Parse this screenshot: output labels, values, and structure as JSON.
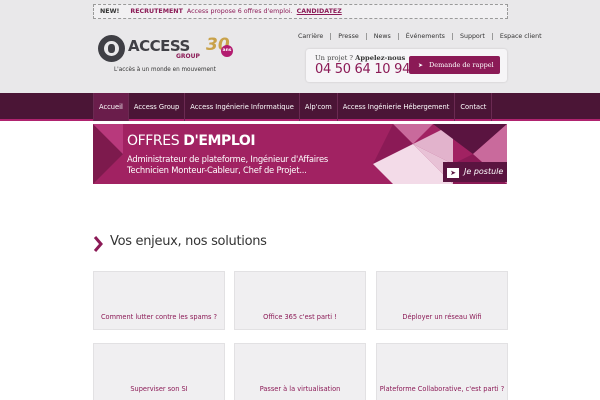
{
  "news": {
    "tag": "NEW!",
    "category": "RECRUTEMENT",
    "message": "Access propose 6 offres d'emploi.",
    "link": "CANDIDATEZ"
  },
  "logo": {
    "name": "ACCESS",
    "sub": "GROUP",
    "anniversary": "30",
    "anniversary_unit": "ans",
    "tagline": "L'accès à un monde en mouvement"
  },
  "top_nav": [
    "Carrière",
    "Presse",
    "News",
    "Événements",
    "Support",
    "Espace client"
  ],
  "call": {
    "prefix": "Un projet ?",
    "bold": "Appelez-nous",
    "phone": "04 50 64 10 94",
    "button": "Demande de rappel"
  },
  "main_nav": [
    {
      "label": "Accueil",
      "active": true
    },
    {
      "label": "Access Group",
      "active": false
    },
    {
      "label": "Access Ingénierie Informatique",
      "active": false
    },
    {
      "label": "Alp'com",
      "active": false
    },
    {
      "label": "Access Ingénierie Hébergement",
      "active": false
    },
    {
      "label": "Contact",
      "active": false
    }
  ],
  "banner": {
    "title_light": "OFFRES",
    "title_bold": "D'EMPLOI",
    "line1": "Administrateur de plateforme, Ingénieur d'Affaires",
    "line2": "Technicien Monteur-Cableur, Chef de Projet...",
    "button": "Je postule"
  },
  "section": {
    "title": "Vos enjeux, nos solutions"
  },
  "cards": [
    "Comment lutter contre les spams ?",
    "Office 365 c'est parti !",
    "Déployer un réseau Wifi",
    "Superviser son SI",
    "Passer à la virtualisation",
    "Plateforme Collaborative, c'est parti ?"
  ],
  "colors": {
    "accent": "#8b1a56",
    "nav_bg": "#4b1536",
    "banner_bg": "#a12262",
    "header_bg": "#e9e8ea"
  }
}
